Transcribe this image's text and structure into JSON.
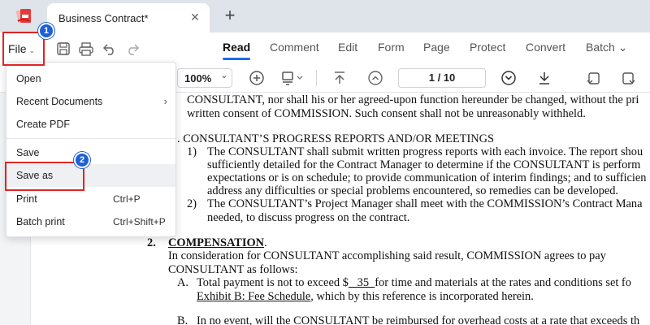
{
  "tabbar": {
    "tab_title": "Business Contract*",
    "close_glyph": "✕",
    "new_tab_glyph": "+"
  },
  "toolbar": {
    "file_label": "File",
    "file_caret": "⌄",
    "icons": [
      "save-icon",
      "print-icon",
      "undo-icon",
      "redo-icon"
    ],
    "menu_tabs": [
      {
        "label": "Read",
        "active": true
      },
      {
        "label": "Comment",
        "active": false
      },
      {
        "label": "Edit",
        "active": false
      },
      {
        "label": "Form",
        "active": false
      },
      {
        "label": "Page",
        "active": false
      },
      {
        "label": "Protect",
        "active": false
      },
      {
        "label": "Convert",
        "active": false
      },
      {
        "label": "Batch ⌄",
        "active": false
      }
    ]
  },
  "subtoolbar": {
    "zoom": "100%",
    "zoom_caret": "⌄",
    "page_indicator": "1 / 10",
    "icons": [
      "zoom-in-icon",
      "view-mode-icon",
      "first-page-icon",
      "previous-page-icon",
      "next-page-icon",
      "last-page-icon",
      "rotate-left-icon",
      "rotate-right-icon"
    ]
  },
  "file_menu": {
    "items": [
      {
        "label": "Open",
        "shortcut": ""
      },
      {
        "label": "Recent Documents",
        "shortcut": "",
        "submenu_arrow": "›"
      },
      {
        "label": "Create PDF",
        "shortcut": ""
      },
      {
        "label": "Save",
        "shortcut": ""
      },
      {
        "label": "Save as",
        "shortcut": ""
      },
      {
        "label": "Print",
        "shortcut": "Ctrl+P"
      },
      {
        "label": "Batch print",
        "shortcut": "Ctrl+Shift+P"
      }
    ]
  },
  "annotations": {
    "step1": "1",
    "step2": "2",
    "highlight_color": "#e02424",
    "badge_color": "#1e5fd6"
  },
  "document": {
    "l1": "CONSULTANT, nor shall his or her agreed-upon function hereunder be changed, without the pri",
    "l2": "written consent of COMMISSION.  Such consent shall not be unreasonably withheld.",
    "l3": ".  CONSULTANT’S PROGRESS REPORTS AND/OR MEETINGS",
    "l4_num": "1)",
    "l4": "The CONSULTANT shall submit written progress reports with each invoice. The report shou",
    "l5": "sufficiently detailed for the Contract Manager to determine if the CONSULTANT is perform",
    "l6": "expectations or is on schedule; to provide communication of interim findings; and to sufficien",
    "l7": "address any difficulties or special problems encountered, so remedies can be developed.",
    "l8_num": "2)",
    "l8": "The CONSULTANT’s Project Manager shall meet with the COMMISSION’s Contract Mana",
    "l9": "needed, to discuss progress on the contract.",
    "l10_num": "2.",
    "l10": "COMPENSATION",
    "l10_end": ".",
    "l11": "In consideration for CONSULTANT accomplishing said result, COMMISSION agrees to pay",
    "l12": "CONSULTANT as follows:",
    "l13_num": "A.",
    "l13a": "Total payment is not to exceed $",
    "l13b": "35",
    "l13c": "for time and materials at the rates and conditions set fo",
    "l14a": "Exhibit B: Fee Schedule",
    "l14b": ", which by this reference is incorporated herein.",
    "l15_num": "B.",
    "l15": "In no event, will the CONSULTANT be reimbursed for overhead costs at a rate that exceeds th"
  }
}
